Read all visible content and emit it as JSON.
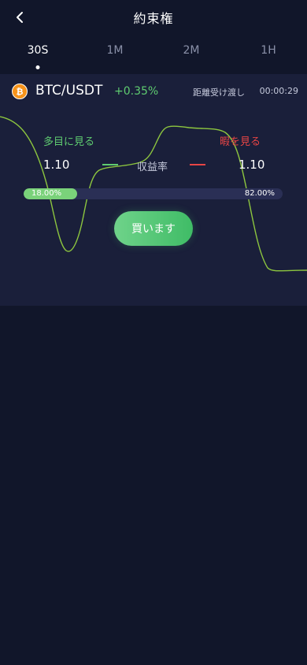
{
  "header": {
    "title": "約束権"
  },
  "tabs": [
    {
      "label": "30S",
      "active": true
    },
    {
      "label": "1M",
      "active": false
    },
    {
      "label": "2M",
      "active": false
    },
    {
      "label": "1H",
      "active": false
    }
  ],
  "pair": {
    "name": "BTC/USDT",
    "change": "+0.35%",
    "icon": "bitcoin-icon"
  },
  "countdown": {
    "label": "距離受け渡し",
    "value": "00:00:29"
  },
  "trade": {
    "long_label": "多目に見る",
    "short_label": "暇を見る",
    "odds_left": "1.10",
    "odds_right": "1.10",
    "yield_label": "収益率"
  },
  "ratio": {
    "long_percent": 18,
    "long_text": "18.00%",
    "short_text": "82.00%"
  },
  "buy_button": {
    "label": "買います"
  },
  "colors": {
    "background": "#11162a",
    "panel": "#1a1f3a",
    "up_green": "#5fcc70",
    "down_red": "#e84545",
    "line": "#8dc63f",
    "bar_track": "#2a2f55"
  }
}
